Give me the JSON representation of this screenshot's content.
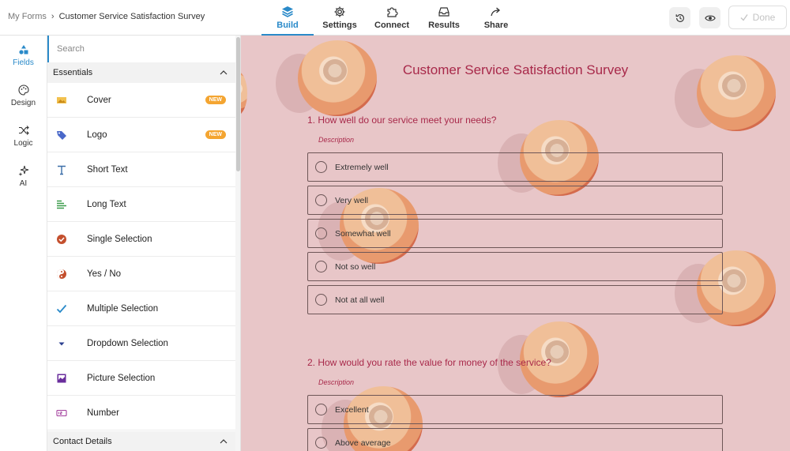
{
  "breadcrumb": {
    "root": "My Forms",
    "separator": "›",
    "current": "Customer Service Satisfaction Survey"
  },
  "nav_tabs": [
    {
      "label": "Build",
      "icon": "layers-icon",
      "active": true
    },
    {
      "label": "Settings",
      "icon": "gear-icon",
      "active": false
    },
    {
      "label": "Connect",
      "icon": "puzzle-icon",
      "active": false
    },
    {
      "label": "Results",
      "icon": "inbox-icon",
      "active": false
    },
    {
      "label": "Share",
      "icon": "share-arrow-icon",
      "active": false
    }
  ],
  "toolbar": {
    "history_icon": "history-icon",
    "preview_icon": "eye-icon",
    "done_label": "Done"
  },
  "rail": [
    {
      "label": "Fields",
      "icon": "shapes-icon",
      "active": true
    },
    {
      "label": "Design",
      "icon": "palette-icon",
      "active": false
    },
    {
      "label": "Logic",
      "icon": "shuffle-icon",
      "active": false
    },
    {
      "label": "AI",
      "icon": "sparkle-icon",
      "active": false
    }
  ],
  "panel": {
    "search_placeholder": "Search",
    "section_essentials": "Essentials",
    "section_contact": "Contact Details",
    "fields": [
      {
        "label": "Cover",
        "icon": "image-icon",
        "badge": "NEW"
      },
      {
        "label": "Logo",
        "icon": "tag-icon",
        "badge": "NEW"
      },
      {
        "label": "Short Text",
        "icon": "text-t-icon"
      },
      {
        "label": "Long Text",
        "icon": "paragraph-icon"
      },
      {
        "label": "Single Selection",
        "icon": "check-circle-icon"
      },
      {
        "label": "Yes / No",
        "icon": "yin-yang-icon"
      },
      {
        "label": "Multiple Selection",
        "icon": "checkmark-icon"
      },
      {
        "label": "Dropdown Selection",
        "icon": "caret-down-icon"
      },
      {
        "label": "Picture Selection",
        "icon": "picture-icon"
      },
      {
        "label": "Number",
        "icon": "number-icon"
      }
    ]
  },
  "form": {
    "title": "Customer Service Satisfaction Survey",
    "questions": [
      {
        "text": "1. How well do our service meet your needs?",
        "description": "Description",
        "options": [
          "Extremely well",
          "Very well",
          "Somewhat well",
          "Not so well",
          "Not at all well"
        ]
      },
      {
        "text": "2. How would you rate the value for money of the service?",
        "description": "Description",
        "options": [
          "Excellent",
          "Above average"
        ]
      }
    ]
  },
  "colors": {
    "accent": "#2a8ac9",
    "form_text": "#a8294a",
    "canvas_bg": "#e8c6c8",
    "badge": "#f4a531"
  }
}
